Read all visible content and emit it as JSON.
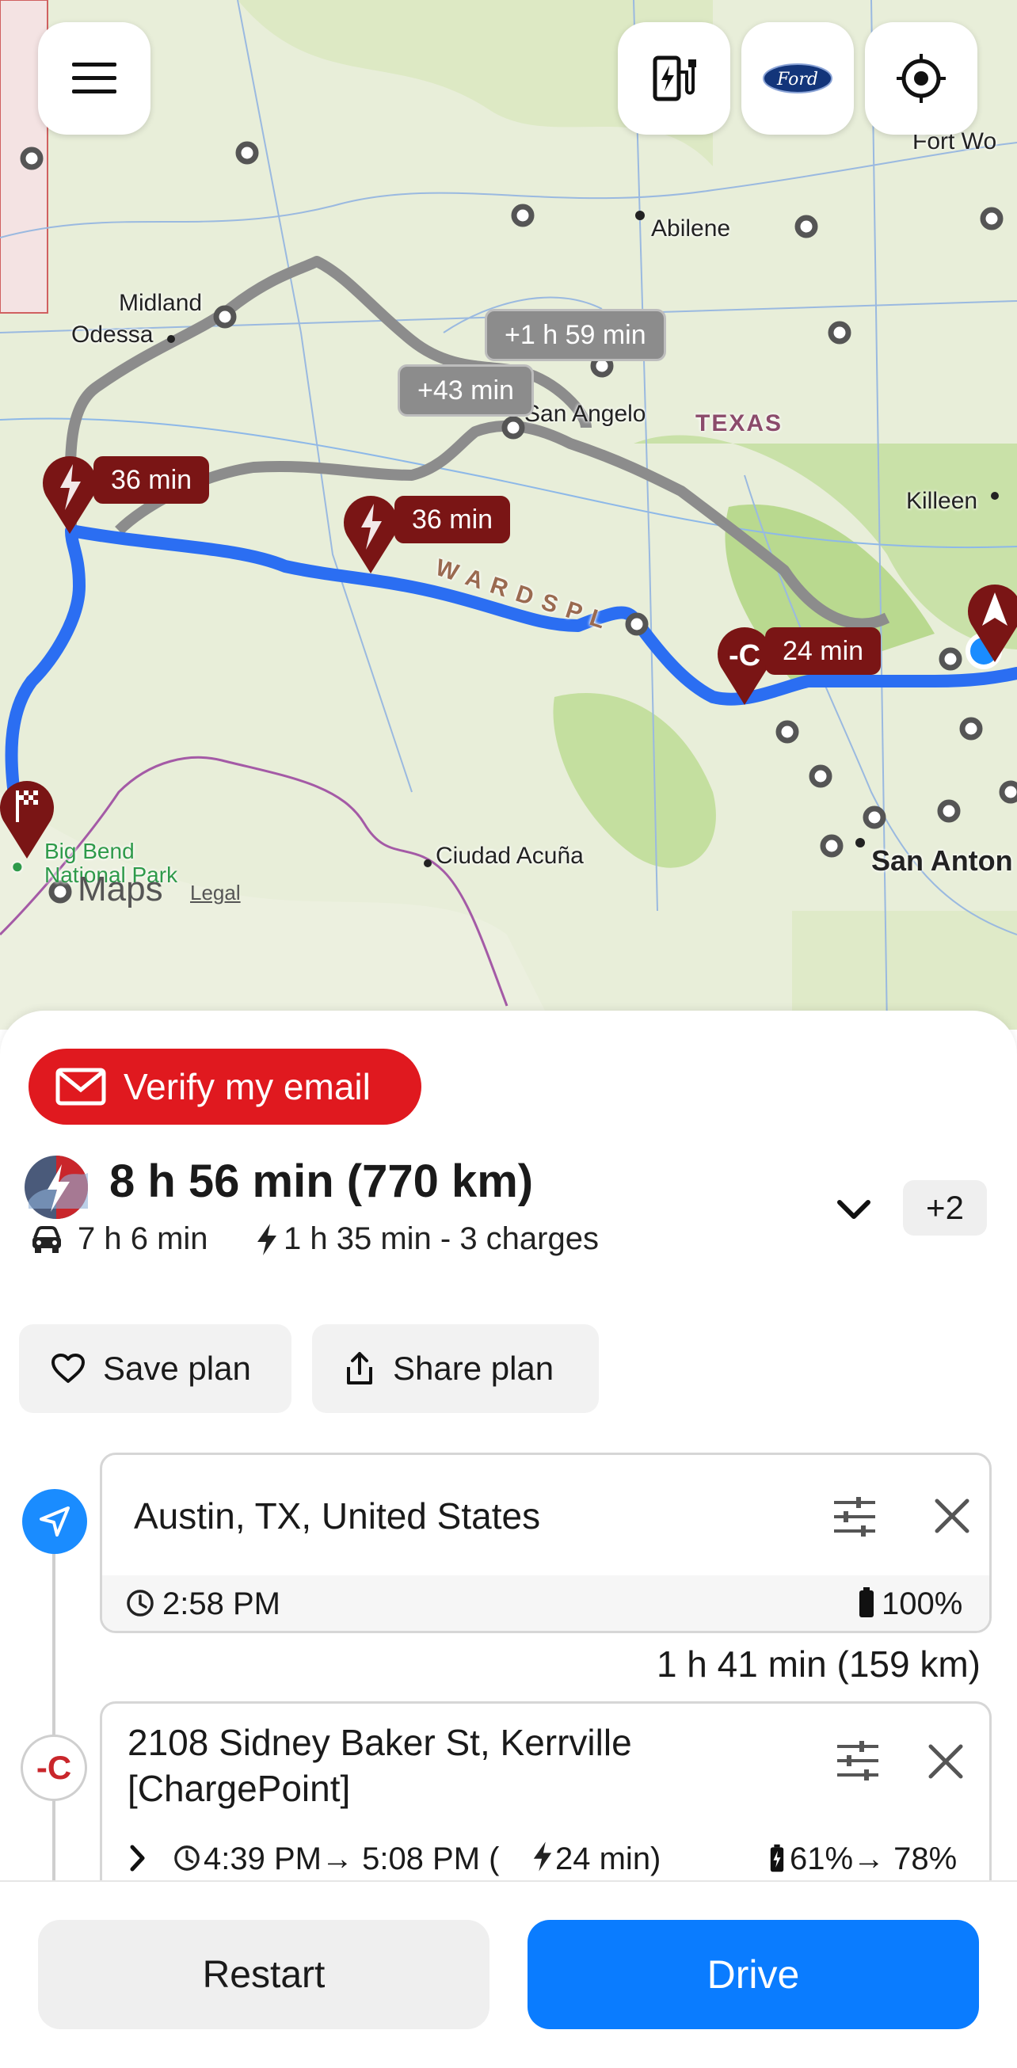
{
  "map": {
    "labels": {
      "fort_worth": "Fort Wo",
      "abilene": "Abilene",
      "midland": "Midland",
      "odessa": "Odessa",
      "san_angelo": "San Angelo",
      "texas": "TEXAS",
      "killeen": "Killeen",
      "edwards_plateau": "W A R D S  P L",
      "ciudad_acuna": "Ciudad Acuña",
      "san_antonio": "San Anton",
      "big_bend": "Big Bend National Park",
      "maps_logo": "Maps",
      "legal": "Legal"
    },
    "route_callouts": {
      "alt1": "+1 h 59 min",
      "alt2": "+43 min",
      "charge1": "36 min",
      "charge2": "36 min",
      "charge3": "24 min"
    },
    "colors": {
      "route": "#2b6ef2",
      "alt_route": "#8c8c8c",
      "pin": "#7a1515"
    }
  },
  "top_buttons": {
    "menu_icon": "hamburger-menu-icon",
    "charger_icon": "ev-charger-icon",
    "ford_label": "Ford",
    "locate_icon": "crosshair-icon"
  },
  "verify": {
    "label": "Verify my email"
  },
  "summary": {
    "title": "8 h 56 min (770 km)",
    "drive_time": "7 h 6 min",
    "charge_time": "1 h 35 min - 3 charges",
    "more_badge": "+2"
  },
  "actions": {
    "save": "Save plan",
    "share": "Share plan"
  },
  "stops": [
    {
      "name": "Austin, TX, United States",
      "time": "2:58 PM",
      "battery": "100%"
    },
    {
      "leg": "1 h 41 min (159 km)",
      "name_line1": "2108 Sidney Baker St, Kerrville",
      "name_line2": "[ChargePoint]",
      "times": "4:39 PM→ 5:08 PM (",
      "charge_dur": "24 min)",
      "battery": "61%→ 78%"
    }
  ],
  "bottom": {
    "restart": "Restart",
    "drive": "Drive"
  }
}
